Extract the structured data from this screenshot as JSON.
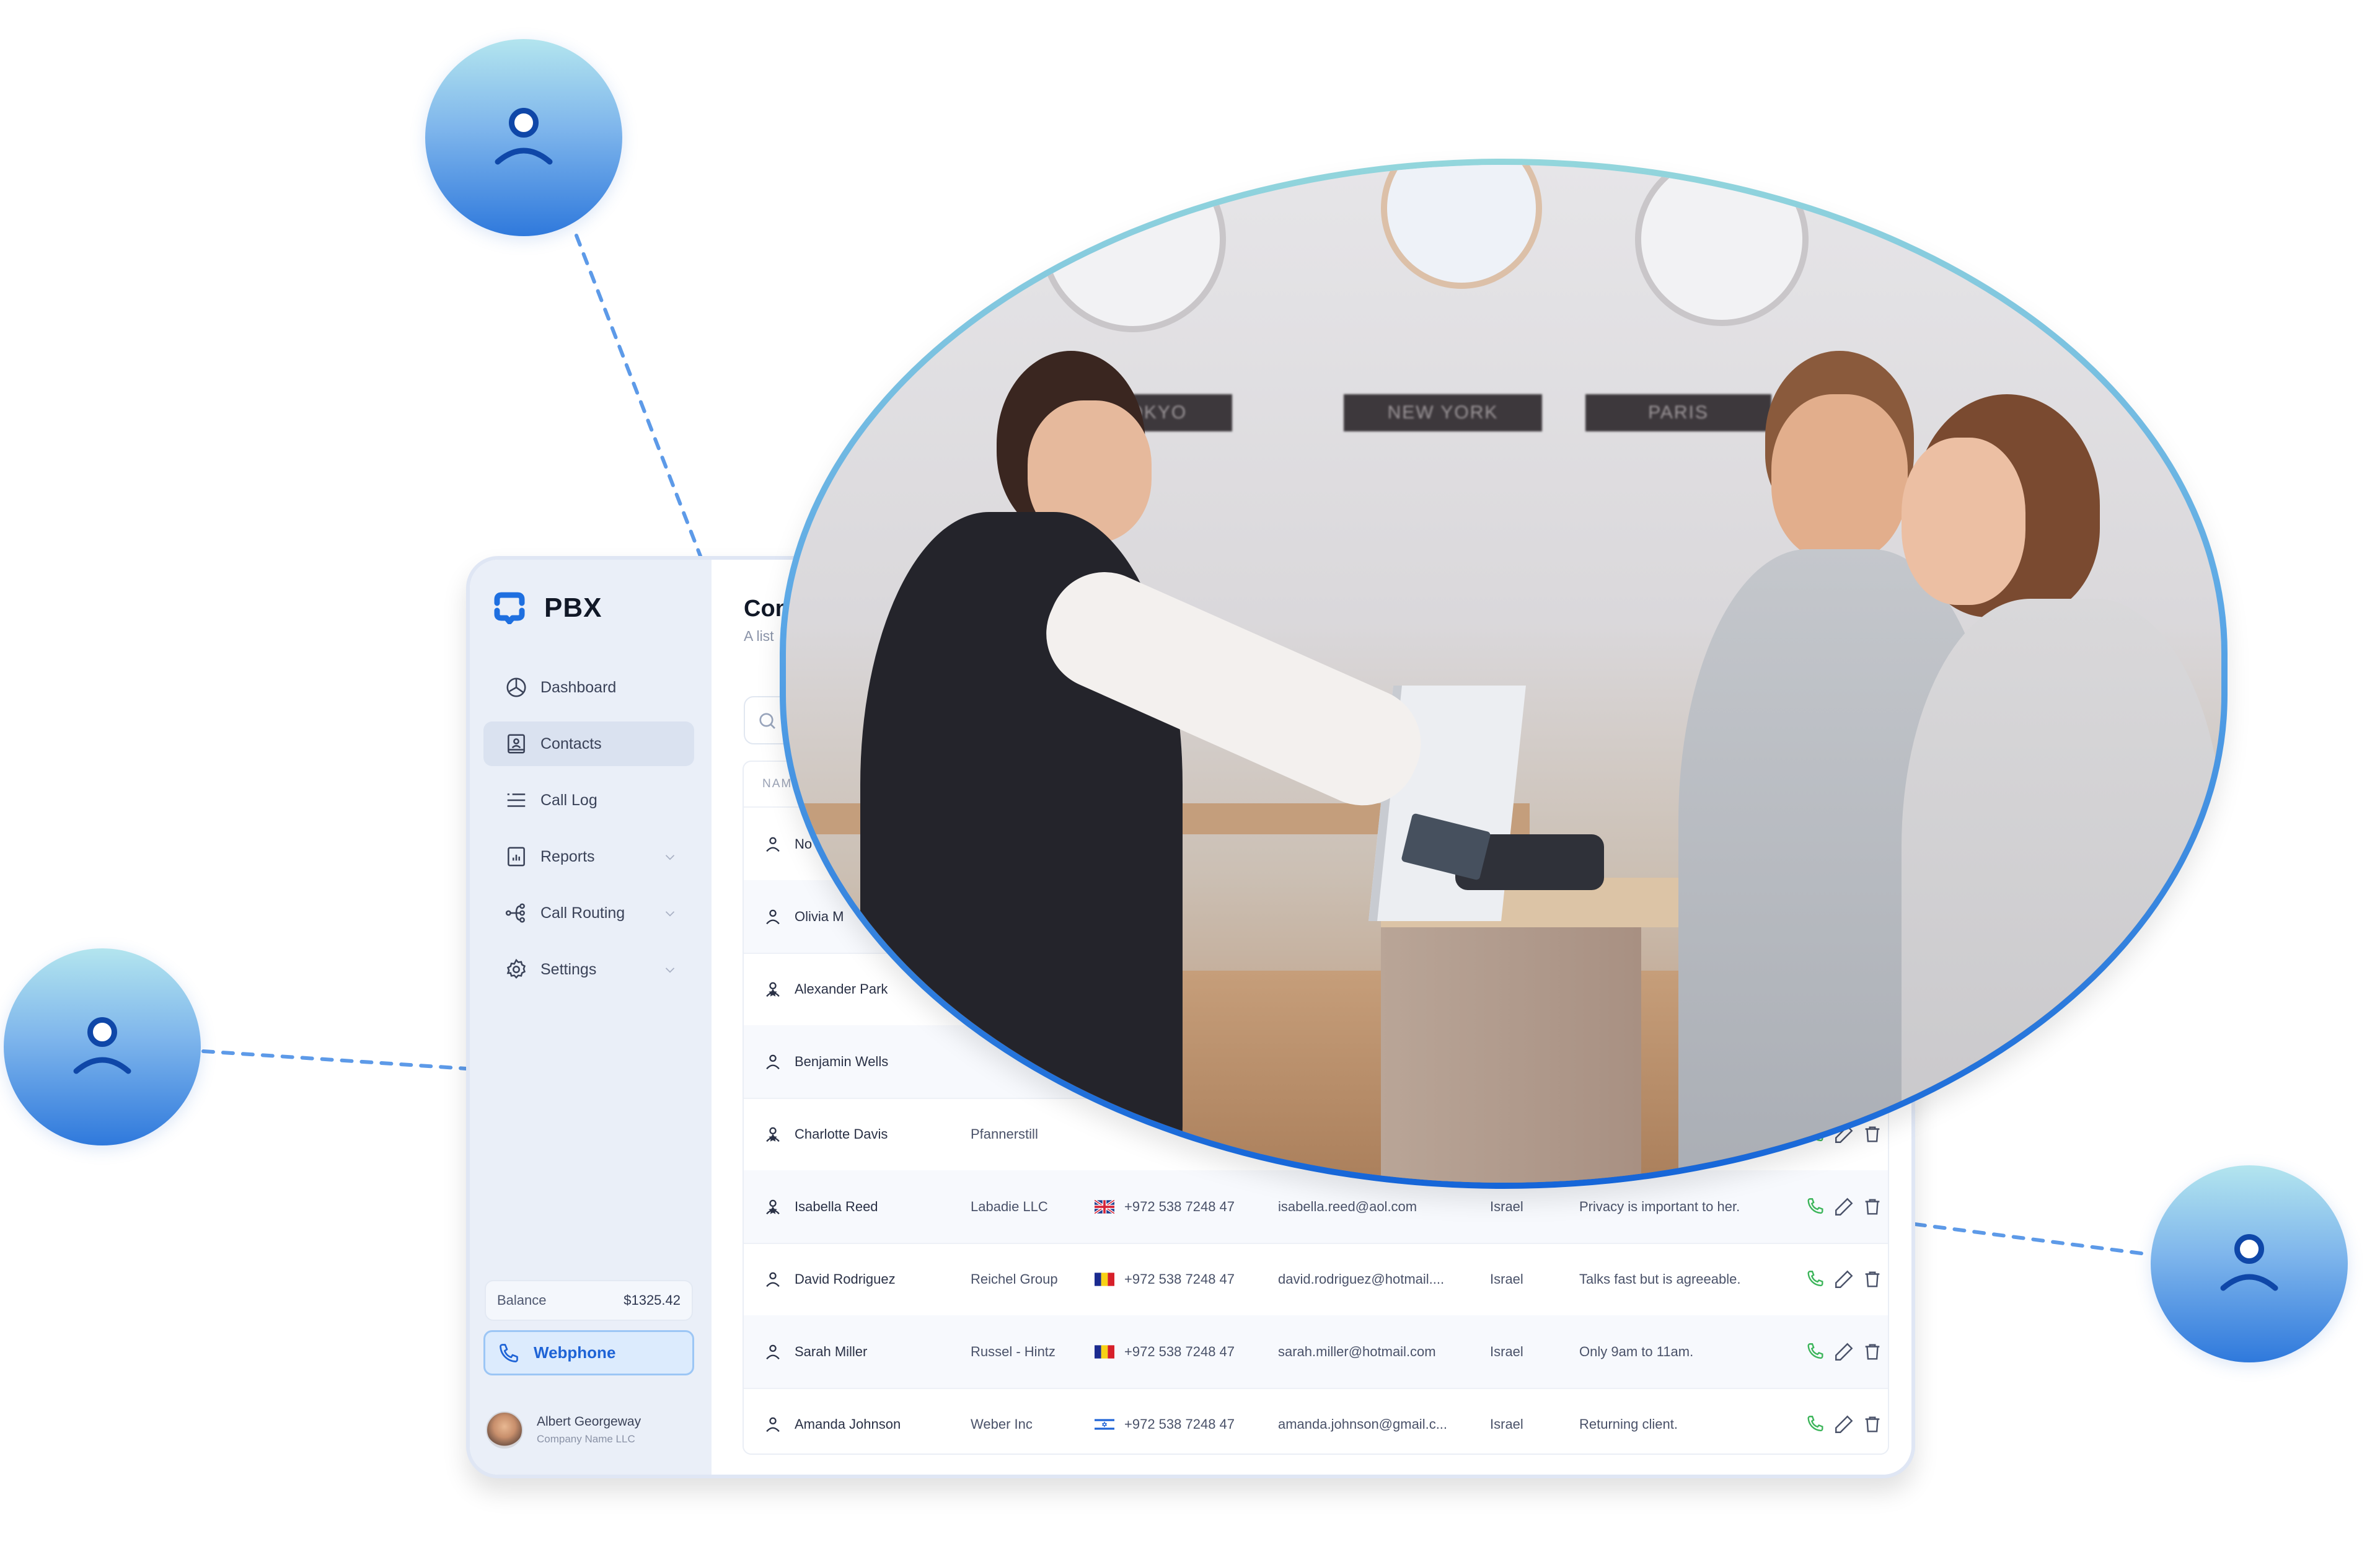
{
  "app": {
    "brand": "PBX",
    "accent_color": "#1e63d6",
    "sidebar": {
      "items": [
        {
          "label": "Dashboard",
          "icon": "pie-chart-icon",
          "active": false,
          "has_submenu": false
        },
        {
          "label": "Contacts",
          "icon": "contact-book-icon",
          "active": true,
          "has_submenu": false
        },
        {
          "label": "Call Log",
          "icon": "list-icon",
          "active": false,
          "has_submenu": false
        },
        {
          "label": "Reports",
          "icon": "report-icon",
          "active": false,
          "has_submenu": true
        },
        {
          "label": "Call Routing",
          "icon": "routing-icon",
          "active": false,
          "has_submenu": true
        },
        {
          "label": "Settings",
          "icon": "gear-icon",
          "active": false,
          "has_submenu": true
        }
      ],
      "balance": {
        "label": "Balance",
        "value": "$1325.42"
      },
      "webphone_label": "Webphone",
      "user": {
        "name": "Albert Georgeway",
        "company": "Company Name LLC"
      }
    },
    "main": {
      "title_visible": "Con",
      "subtitle_visible": "A list",
      "search_placeholder": "",
      "table": {
        "header_visible": "NAM",
        "rows": [
          {
            "name": "No",
            "company": "",
            "flag": "",
            "phone": "",
            "email": "",
            "country": "",
            "note": "",
            "icon": "user-icon"
          },
          {
            "name": "Olivia M",
            "company": "",
            "flag": "",
            "phone": "",
            "email": "",
            "country": "",
            "note": "",
            "icon": "user-icon"
          },
          {
            "name": "Alexander Park",
            "company": "",
            "flag": "",
            "phone": "",
            "email": "",
            "country": "",
            "note": "",
            "icon": "user-star-icon"
          },
          {
            "name": "Benjamin Wells",
            "company": "",
            "flag": "",
            "phone": "",
            "email": "",
            "country": "",
            "note": "",
            "icon": "user-icon"
          },
          {
            "name": "Charlotte Davis",
            "company": "Pfannerstill",
            "flag": "",
            "phone": "",
            "email": "",
            "country": "",
            "note": "",
            "icon": "user-star-icon"
          },
          {
            "name": "Isabella Reed",
            "company": "Labadie LLC",
            "flag": "uk",
            "phone": "+972 538 7248 47",
            "email": "isabella.reed@aol.com",
            "country": "Israel",
            "note": "Privacy is important to her.",
            "icon": "user-star-icon"
          },
          {
            "name": "David Rodriguez",
            "company": "Reichel Group",
            "flag": "romania",
            "phone": "+972 538 7248 47",
            "email": "david.rodriguez@hotmail....",
            "country": "Israel",
            "note": "Talks fast but is agreeable.",
            "icon": "user-icon"
          },
          {
            "name": "Sarah Miller",
            "company": "Russel - Hintz",
            "flag": "romania",
            "phone": "+972 538 7248 47",
            "email": "sarah.miller@hotmail.com",
            "country": "Israel",
            "note": "Only 9am to 11am.",
            "icon": "user-icon"
          },
          {
            "name": "Amanda Johnson",
            "company": "Weber Inc",
            "flag": "israel",
            "phone": "+972 538 7248 47",
            "email": "amanda.johnson@gmail.c...",
            "country": "Israel",
            "note": "Returning client.",
            "icon": "user-icon"
          }
        ],
        "row_actions": [
          "call-icon",
          "edit-icon",
          "delete-icon"
        ]
      }
    }
  },
  "photo": {
    "description": "Receptionist at hotel front desk handing a credit card to a smiling couple",
    "wall_labels": [
      "TOKYO",
      "NEW YORK",
      "PARIS"
    ]
  },
  "floating_contacts": [
    {
      "icon": "user-icon",
      "position": "top-left"
    },
    {
      "icon": "user-icon",
      "position": "left"
    },
    {
      "icon": "user-icon",
      "position": "right"
    }
  ]
}
